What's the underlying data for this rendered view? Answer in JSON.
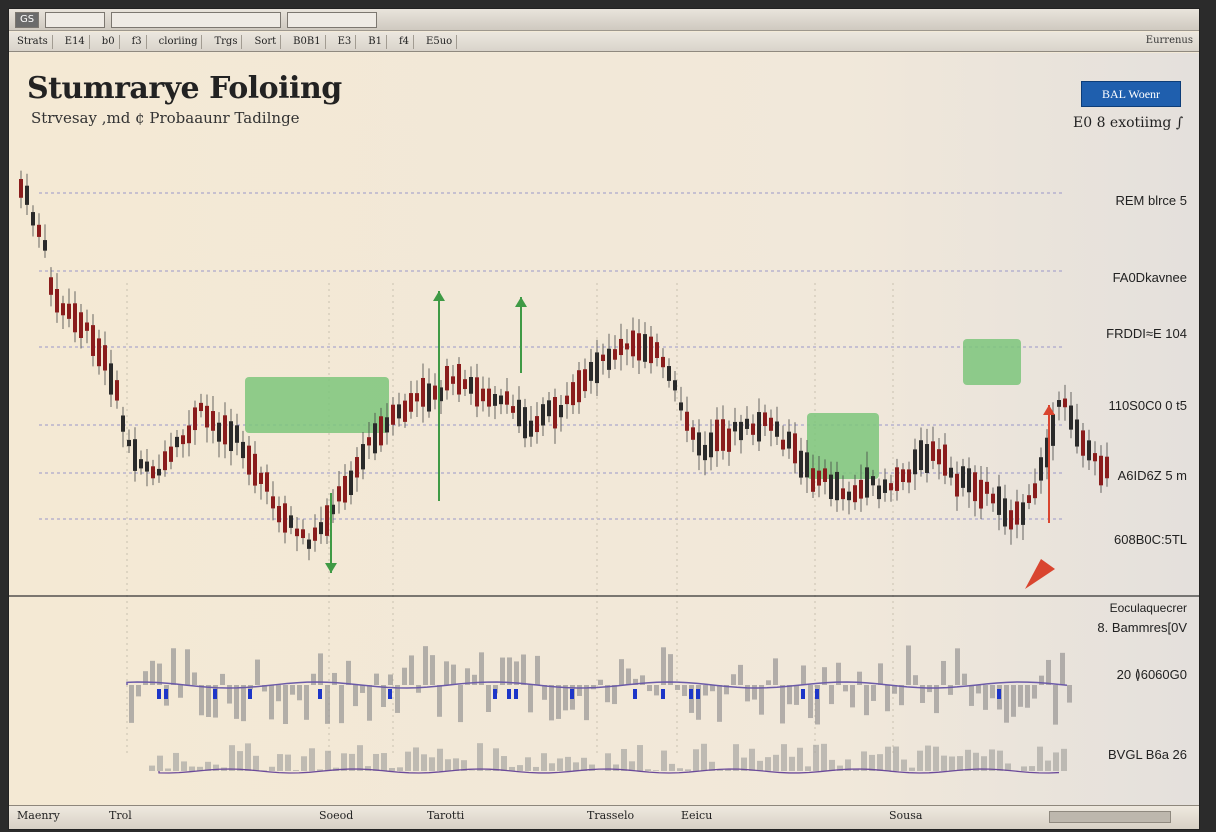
{
  "window": {
    "title_chips": [
      "GS",
      "",
      "",
      ""
    ],
    "toolbar_items": [
      "Strats",
      "E14",
      "b0",
      "f3",
      "cloriing",
      "Trgs",
      "Sort",
      "B0B1",
      "E3",
      "B1",
      "f4",
      "E5uo"
    ],
    "toolbar_right": "Eurrenus"
  },
  "header": {
    "title": "Stumrarye Foloiing",
    "subtitle": "Strvesay ,md ¢ Probaaunr Tadilnge",
    "action_button": "BAL Woenr",
    "note": "E0 8 exotiimg ∫"
  },
  "price_labels": [
    "REM blrce 5",
    "FA0Dkavnee",
    "FRDDI≈E 104",
    "110S0C0 0 t5",
    "A6ID6Z 5 m",
    "608B0C:5TL"
  ],
  "indicator_labels": [
    "Eoculaquecrer",
    "8. Bammres[0V",
    "20 ≬6060G0",
    "BVGL B6a 26"
  ],
  "axis_labels": [
    "Maenry",
    "Trol",
    "Soeod",
    "Tarotti",
    "Trasselo",
    "Eeicu",
    "Sousa"
  ],
  "colors": {
    "background": "#f3ead8",
    "candle_up": "#2a2a2a",
    "candle_down": "#8a1c1c",
    "green_zone": "#7dc57b",
    "green_arrow": "#3f9a45",
    "red_arrow": "#d9452f",
    "accent_button": "#1f5fae"
  }
}
